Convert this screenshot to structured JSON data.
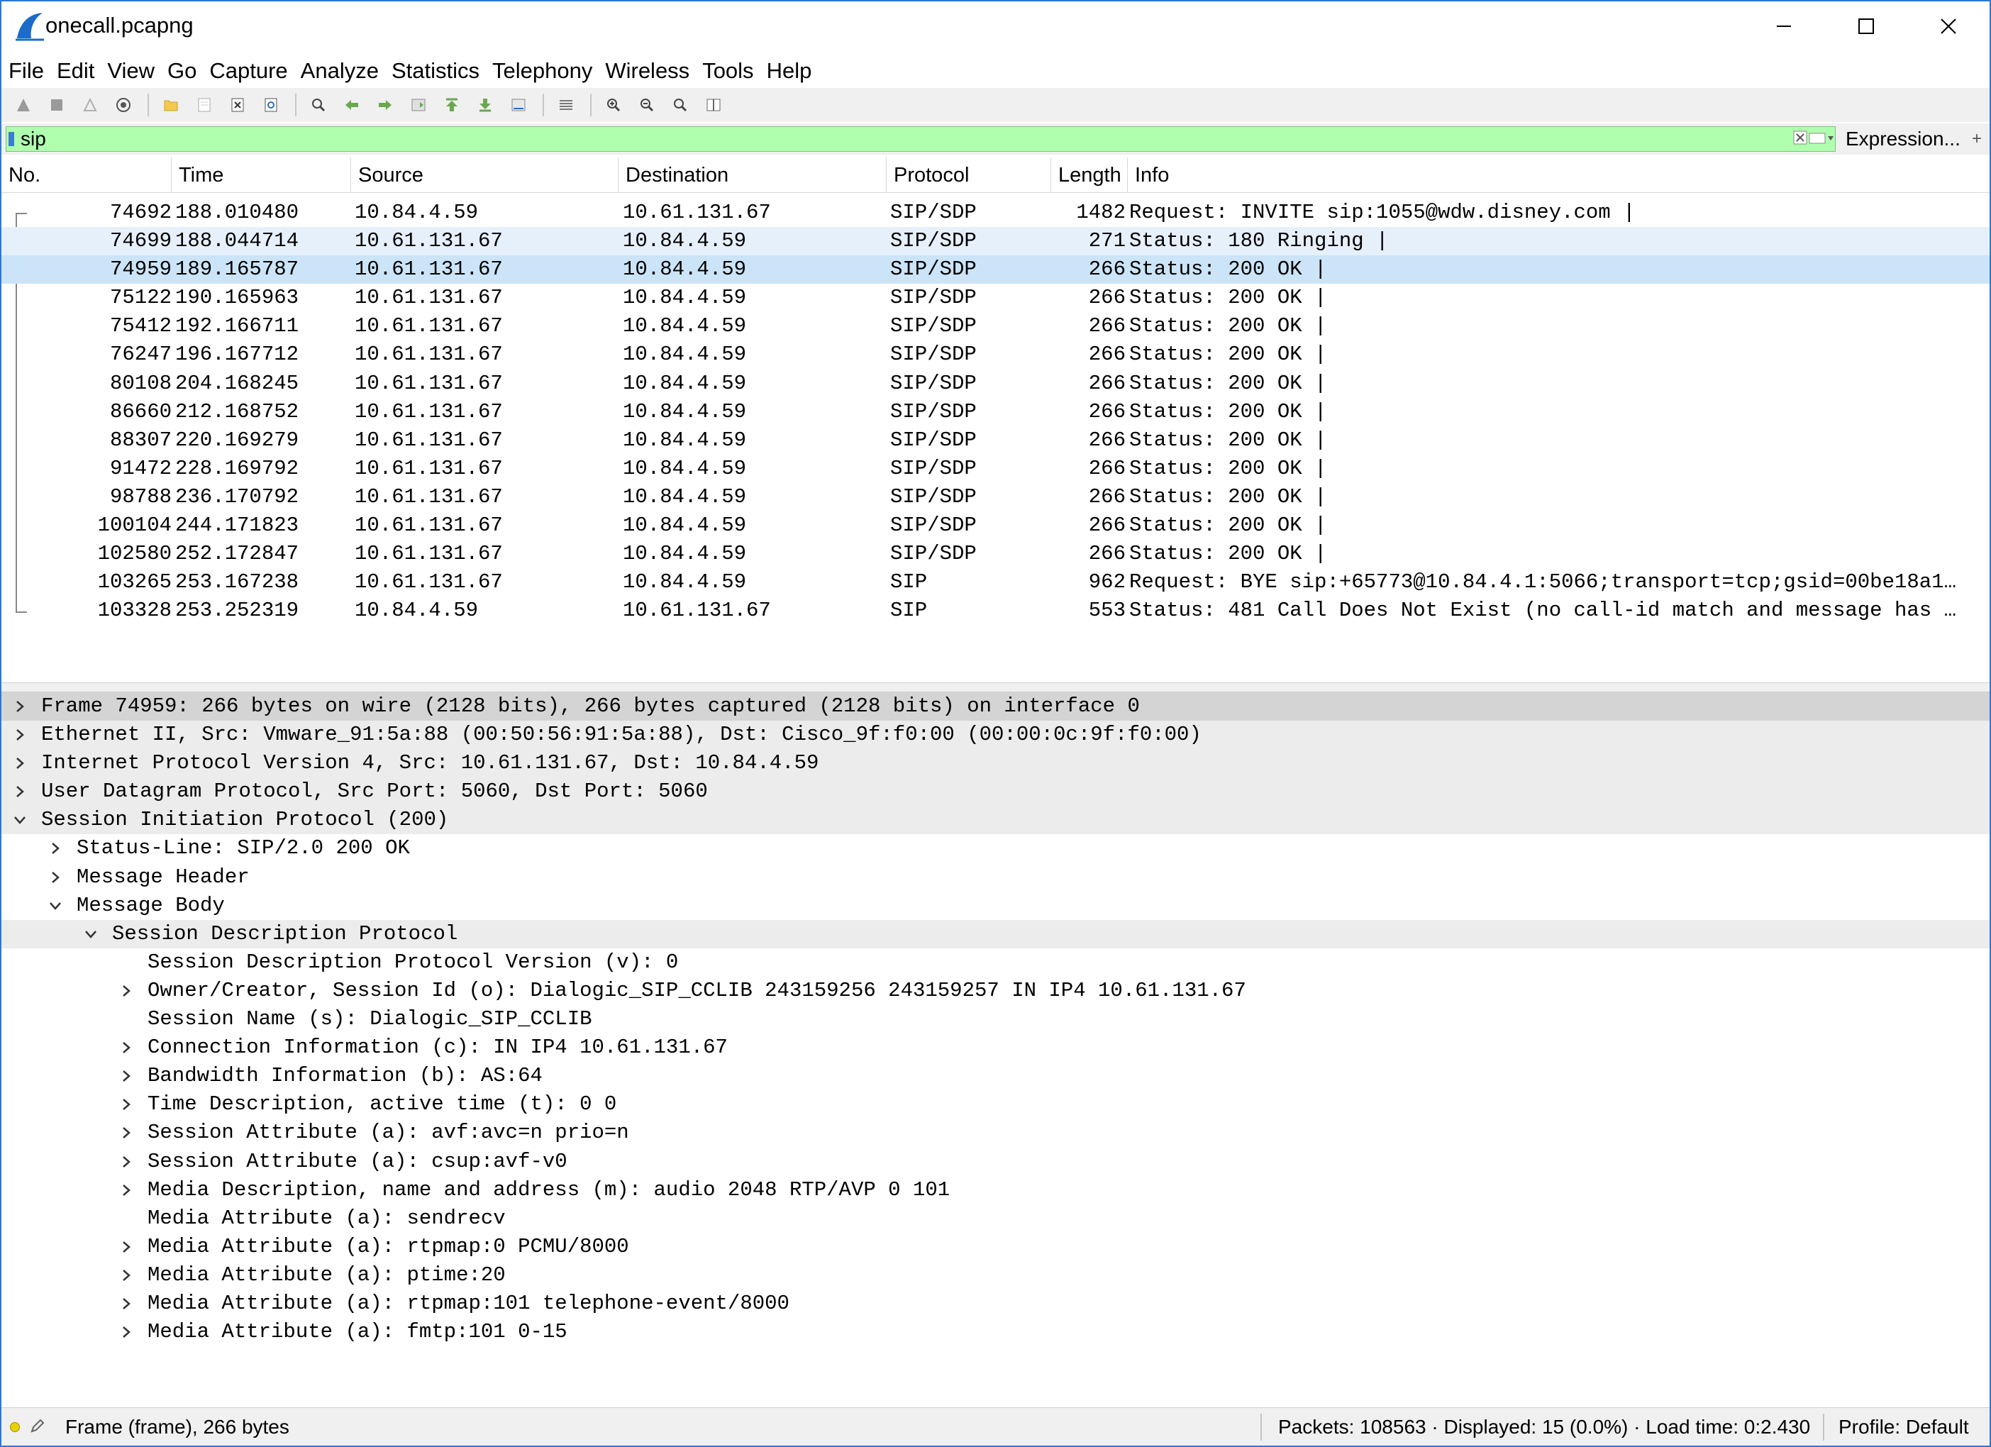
{
  "window": {
    "title": "onecall.pcapng",
    "controls": {
      "minimize": "minimize-icon",
      "maximize": "maximize-icon",
      "close": "close-icon"
    }
  },
  "menu": [
    "File",
    "Edit",
    "View",
    "Go",
    "Capture",
    "Analyze",
    "Statistics",
    "Telephony",
    "Wireless",
    "Tools",
    "Help"
  ],
  "toolbar": {
    "icons": [
      "start-capture-icon",
      "stop-capture-icon",
      "restart-capture-icon",
      "capture-options-icon",
      "open-file-icon",
      "save-file-icon",
      "close-file-icon",
      "reload-file-icon",
      "find-packet-icon",
      "go-back-icon",
      "go-forward-icon",
      "go-to-packet-icon",
      "go-first-icon",
      "go-last-icon",
      "auto-scroll-icon",
      "colorize-icon",
      "zoom-in-icon",
      "zoom-out-icon",
      "zoom-normal-icon",
      "resize-columns-icon"
    ]
  },
  "filter": {
    "value": "sip",
    "expression_label": "Expression...",
    "plus_label": "+"
  },
  "packet_list": {
    "columns": [
      "No.",
      "Time",
      "Source",
      "Destination",
      "Protocol",
      "Length",
      "Info"
    ],
    "rows": [
      {
        "no": "74692",
        "time": "188.010480",
        "src": "10.84.4.59",
        "dst": "10.61.131.67",
        "proto": "SIP/SDP",
        "len": "1482",
        "info": "Request: INVITE sip:1055@wdw.disney.com |"
      },
      {
        "no": "74699",
        "time": "188.044714",
        "src": "10.61.131.67",
        "dst": "10.84.4.59",
        "proto": "SIP/SDP",
        "len": "271",
        "info": "Status: 180 Ringing |"
      },
      {
        "no": "74959",
        "time": "189.165787",
        "src": "10.61.131.67",
        "dst": "10.84.4.59",
        "proto": "SIP/SDP",
        "len": "266",
        "info": "Status: 200 OK |"
      },
      {
        "no": "75122",
        "time": "190.165963",
        "src": "10.61.131.67",
        "dst": "10.84.4.59",
        "proto": "SIP/SDP",
        "len": "266",
        "info": "Status: 200 OK |"
      },
      {
        "no": "75412",
        "time": "192.166711",
        "src": "10.61.131.67",
        "dst": "10.84.4.59",
        "proto": "SIP/SDP",
        "len": "266",
        "info": "Status: 200 OK |"
      },
      {
        "no": "76247",
        "time": "196.167712",
        "src": "10.61.131.67",
        "dst": "10.84.4.59",
        "proto": "SIP/SDP",
        "len": "266",
        "info": "Status: 200 OK |"
      },
      {
        "no": "80108",
        "time": "204.168245",
        "src": "10.61.131.67",
        "dst": "10.84.4.59",
        "proto": "SIP/SDP",
        "len": "266",
        "info": "Status: 200 OK |"
      },
      {
        "no": "86660",
        "time": "212.168752",
        "src": "10.61.131.67",
        "dst": "10.84.4.59",
        "proto": "SIP/SDP",
        "len": "266",
        "info": "Status: 200 OK |"
      },
      {
        "no": "88307",
        "time": "220.169279",
        "src": "10.61.131.67",
        "dst": "10.84.4.59",
        "proto": "SIP/SDP",
        "len": "266",
        "info": "Status: 200 OK |"
      },
      {
        "no": "91472",
        "time": "228.169792",
        "src": "10.61.131.67",
        "dst": "10.84.4.59",
        "proto": "SIP/SDP",
        "len": "266",
        "info": "Status: 200 OK |"
      },
      {
        "no": "98788",
        "time": "236.170792",
        "src": "10.61.131.67",
        "dst": "10.84.4.59",
        "proto": "SIP/SDP",
        "len": "266",
        "info": "Status: 200 OK |"
      },
      {
        "no": "100104",
        "time": "244.171823",
        "src": "10.61.131.67",
        "dst": "10.84.4.59",
        "proto": "SIP/SDP",
        "len": "266",
        "info": "Status: 200 OK |"
      },
      {
        "no": "102580",
        "time": "252.172847",
        "src": "10.61.131.67",
        "dst": "10.84.4.59",
        "proto": "SIP/SDP",
        "len": "266",
        "info": "Status: 200 OK |"
      },
      {
        "no": "103265",
        "time": "253.167238",
        "src": "10.61.131.67",
        "dst": "10.84.4.59",
        "proto": "SIP",
        "len": "962",
        "info": "Request: BYE sip:+65773@10.84.4.1:5066;transport=tcp;gsid=00be18a1…"
      },
      {
        "no": "103328",
        "time": "253.252319",
        "src": "10.84.4.59",
        "dst": "10.61.131.67",
        "proto": "SIP",
        "len": "553",
        "info": "Status: 481 Call Does Not Exist (no call-id match and message has …"
      }
    ]
  },
  "details": [
    {
      "text": "Frame 74959: 266 bytes on wire (2128 bits), 266 bytes captured (2128 bits) on interface 0",
      "indent": 0,
      "state": "collapsed",
      "style": "selgray"
    },
    {
      "text": "Ethernet II, Src: Vmware_91:5a:88 (00:50:56:91:5a:88), Dst: Cisco_9f:f0:00 (00:00:0c:9f:f0:00)",
      "indent": 0,
      "state": "collapsed",
      "style": "gray"
    },
    {
      "text": "Internet Protocol Version 4, Src: 10.61.131.67, Dst: 10.84.4.59",
      "indent": 0,
      "state": "collapsed",
      "style": "gray"
    },
    {
      "text": "User Datagram Protocol, Src Port: 5060, Dst Port: 5060",
      "indent": 0,
      "state": "collapsed",
      "style": "gray"
    },
    {
      "text": "Session Initiation Protocol (200)",
      "indent": 0,
      "state": "expanded",
      "style": "gray"
    },
    {
      "text": "Status-Line: SIP/2.0 200 OK",
      "indent": 1,
      "state": "collapsed",
      "style": ""
    },
    {
      "text": "Message Header",
      "indent": 1,
      "state": "collapsed",
      "style": ""
    },
    {
      "text": "Message Body",
      "indent": 1,
      "state": "expanded",
      "style": ""
    },
    {
      "text": "Session Description Protocol",
      "indent": 2,
      "state": "expanded",
      "style": "gray"
    },
    {
      "text": "Session Description Protocol Version (v): 0",
      "indent": 3,
      "state": "leaf",
      "style": ""
    },
    {
      "text": "Owner/Creator, Session Id (o): Dialogic_SIP_CCLIB 243159256 243159257 IN IP4 10.61.131.67",
      "indent": 3,
      "state": "collapsed",
      "style": ""
    },
    {
      "text": "Session Name (s): Dialogic_SIP_CCLIB",
      "indent": 3,
      "state": "leaf",
      "style": ""
    },
    {
      "text": "Connection Information (c): IN IP4 10.61.131.67",
      "indent": 3,
      "state": "collapsed",
      "style": ""
    },
    {
      "text": "Bandwidth Information (b): AS:64",
      "indent": 3,
      "state": "collapsed",
      "style": ""
    },
    {
      "text": "Time Description, active time (t): 0 0",
      "indent": 3,
      "state": "collapsed",
      "style": ""
    },
    {
      "text": "Session Attribute (a): avf:avc=n prio=n",
      "indent": 3,
      "state": "collapsed",
      "style": ""
    },
    {
      "text": "Session Attribute (a): csup:avf-v0",
      "indent": 3,
      "state": "collapsed",
      "style": ""
    },
    {
      "text": "Media Description, name and address (m): audio 2048 RTP/AVP 0 101",
      "indent": 3,
      "state": "collapsed",
      "style": ""
    },
    {
      "text": "Media Attribute (a): sendrecv",
      "indent": 3,
      "state": "leaf",
      "style": ""
    },
    {
      "text": "Media Attribute (a): rtpmap:0 PCMU/8000",
      "indent": 3,
      "state": "collapsed",
      "style": ""
    },
    {
      "text": "Media Attribute (a): ptime:20",
      "indent": 3,
      "state": "collapsed",
      "style": ""
    },
    {
      "text": "Media Attribute (a): rtpmap:101 telephone-event/8000",
      "indent": 3,
      "state": "collapsed",
      "style": ""
    },
    {
      "text": "Media Attribute (a): fmtp:101 0-15",
      "indent": 3,
      "state": "collapsed",
      "style": ""
    }
  ],
  "statusbar": {
    "frame_info": "Frame (frame), 266 bytes",
    "packets_info": "Packets: 108563 · Displayed: 15 (0.0%) · Load time: 0:2.430",
    "profile": "Profile: Default"
  },
  "colors": {
    "filter_ok": "#afffaf",
    "selected_row": "#cce4f7",
    "related_row": "#e6f0fb",
    "accent": "#2b78d8"
  }
}
